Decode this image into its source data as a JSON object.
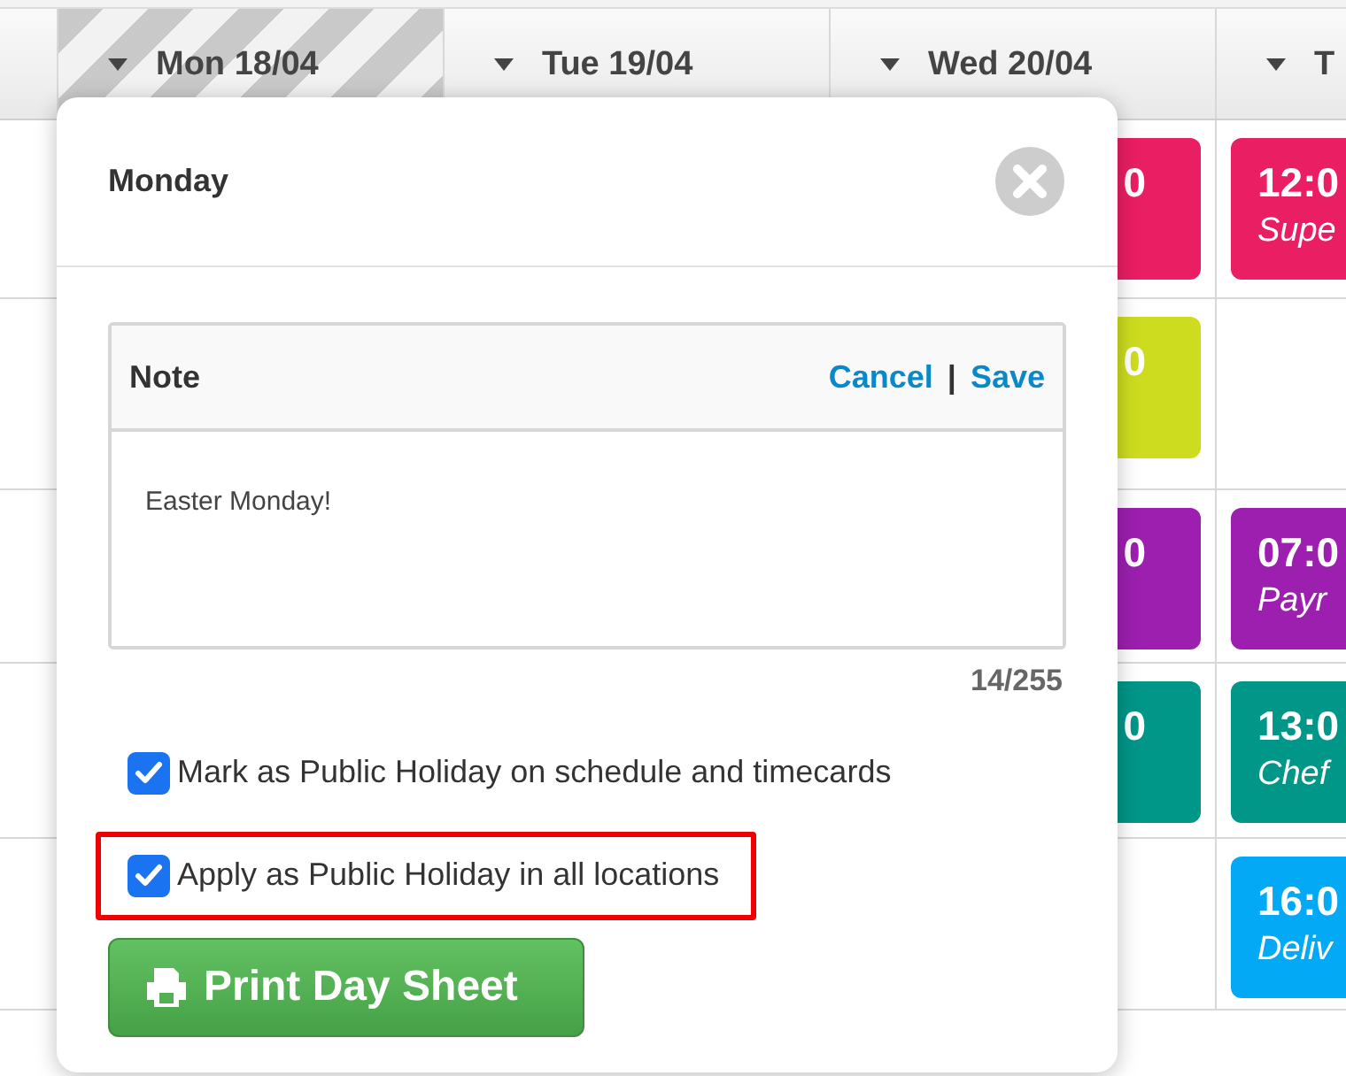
{
  "columns": [
    {
      "label": "Mon 18/04",
      "holiday": true
    },
    {
      "label": "Tue 19/04",
      "holiday": false
    },
    {
      "label": "Wed 20/04",
      "holiday": false
    },
    {
      "label": "T",
      "holiday": false
    }
  ],
  "shift_rows": [
    {
      "wed_shift": {
        "time": "0",
        "color": "#e91e63"
      },
      "thu_shift": {
        "time": "12:0",
        "role": "Supe",
        "color": "#e91e63"
      }
    },
    {
      "wed_shift": {
        "time": "0",
        "color": "#cddc1f"
      }
    },
    {
      "wed_shift": {
        "time": "0",
        "color": "#9c1fb0"
      },
      "thu_shift": {
        "time": "07:0",
        "role": "Payr",
        "color": "#9c1fb0"
      }
    },
    {
      "wed_shift": {
        "time": "0",
        "color": "#009688"
      },
      "thu_shift": {
        "time": "13:0",
        "role": "Chef",
        "color": "#009688"
      }
    },
    {
      "thu_shift": {
        "time": "16:0",
        "role": "Deliv",
        "color": "#03a9f4"
      }
    }
  ],
  "dialog": {
    "title": "Monday",
    "note": {
      "label": "Note",
      "cancel": "Cancel",
      "separator": "|",
      "save": "Save",
      "value": "Easter Monday!",
      "counter": "14/255"
    },
    "options": [
      {
        "label": "Mark as Public Holiday on schedule and timecards",
        "checked": true,
        "highlighted": false
      },
      {
        "label": "Apply as Public Holiday in all locations",
        "checked": true,
        "highlighted": true
      }
    ],
    "print_button": "Print Day Sheet"
  }
}
